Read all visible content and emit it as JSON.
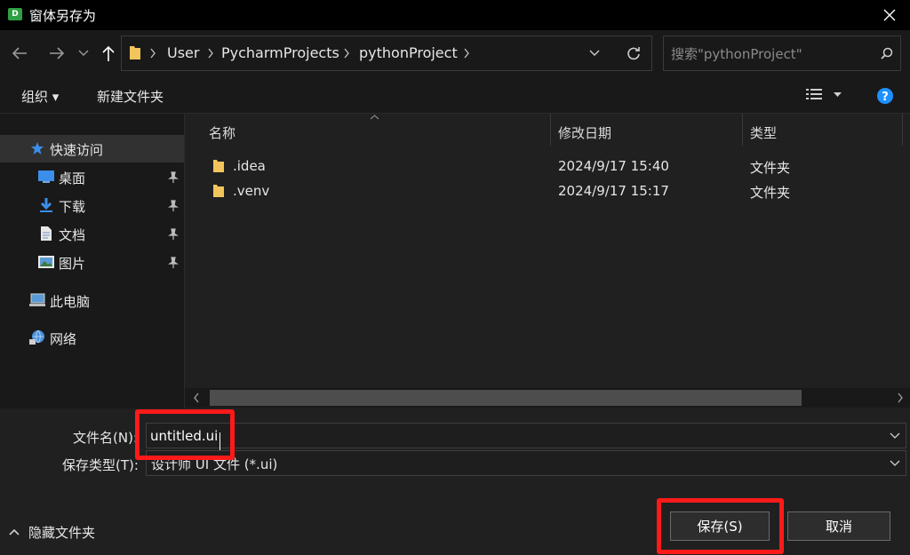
{
  "window": {
    "icon_letter": "D",
    "title": "窗体另存为"
  },
  "address": {
    "crumbs": [
      "User",
      "PycharmProjects",
      "pythonProject"
    ]
  },
  "search": {
    "placeholder": "搜索\"pythonProject\""
  },
  "toolbar": {
    "organize_label": "组织 ▾",
    "new_folder_label": "新建文件夹"
  },
  "nav": {
    "quick_access": "快速访问",
    "items": [
      {
        "label": "桌面",
        "icon": "desktop-icon"
      },
      {
        "label": "下载",
        "icon": "download-icon"
      },
      {
        "label": "文档",
        "icon": "document-icon"
      },
      {
        "label": "图片",
        "icon": "pictures-icon"
      }
    ],
    "this_pc": "此电脑",
    "network": "网络"
  },
  "file_list": {
    "columns": [
      "名称",
      "修改日期",
      "类型"
    ],
    "rows": [
      {
        "name": ".idea",
        "modified": "2024/9/17 15:40",
        "type": "文件夹"
      },
      {
        "name": ".venv",
        "modified": "2024/9/17 15:17",
        "type": "文件夹"
      }
    ]
  },
  "form": {
    "filename_label": "文件名(N):",
    "filename_value": "untitled.ui",
    "filetype_label": "保存类型(T):",
    "filetype_value": "设计师 UI 文件 (*.ui)"
  },
  "footer": {
    "hide_folders": "隐藏文件夹",
    "save_label": "保存(S)",
    "cancel_label": "取消"
  },
  "colors": {
    "highlight": "#ff1a1a",
    "folder": "#f2c55c",
    "help": "#1e90ff",
    "quick_access_star": "#3b8eea"
  }
}
